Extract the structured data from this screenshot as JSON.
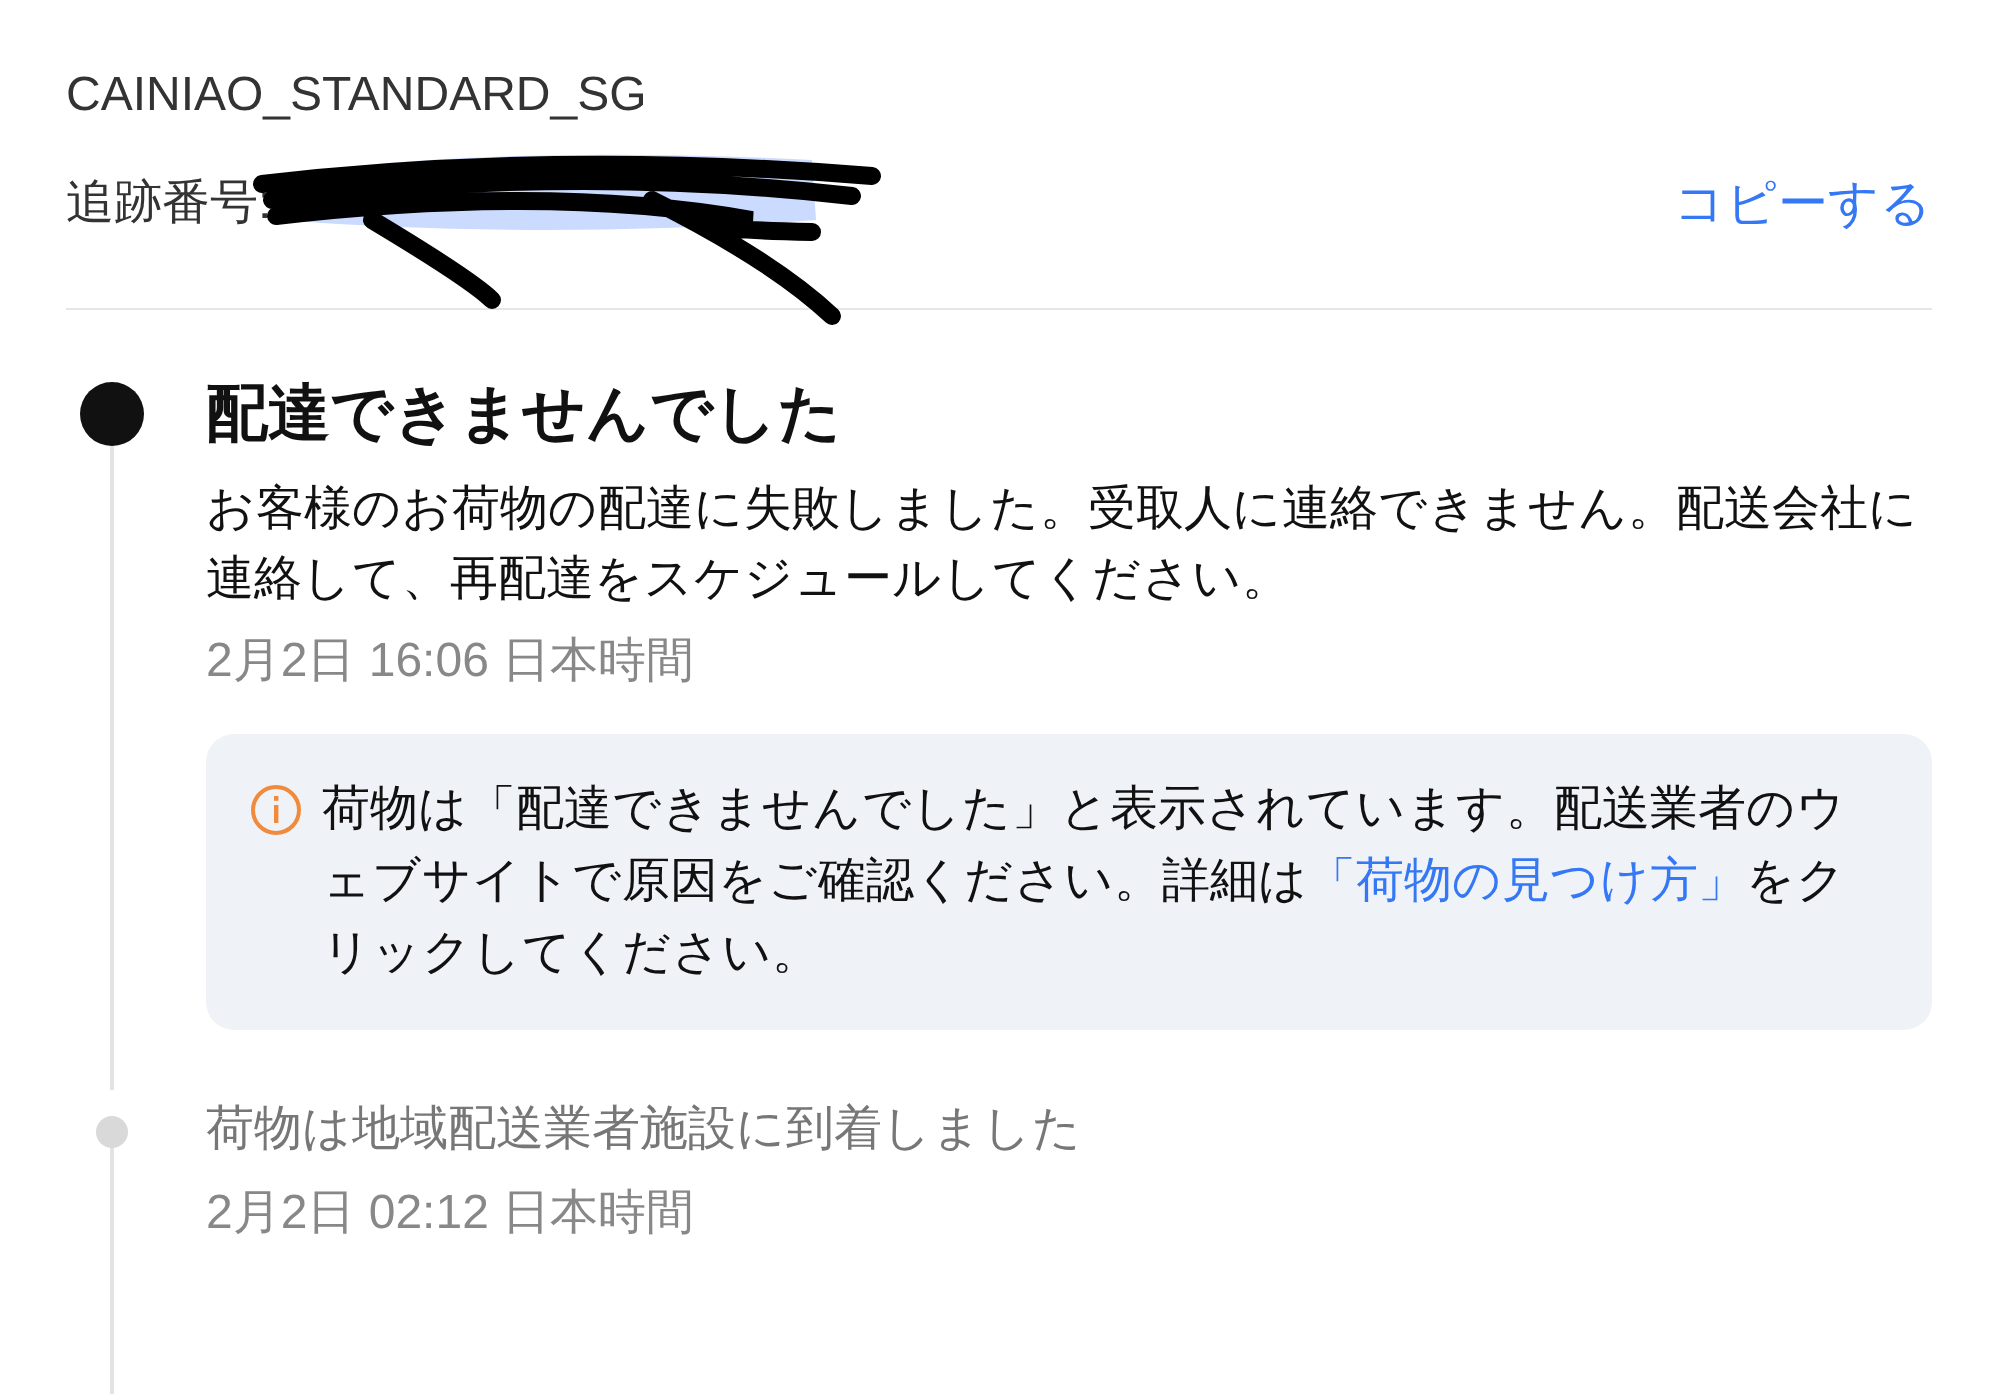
{
  "carrier": "CAINIAO_STANDARD_SG",
  "tracking": {
    "label": "追跡番号:",
    "copy_button": "コピーする"
  },
  "events": [
    {
      "kind": "current",
      "title": "配達できませんでした",
      "description": "お客様のお荷物の配達に失敗しました。受取人に連絡できません。配送会社に連絡して、再配達をスケジュールしてください。",
      "time": "2月2日 16:06 日本時間",
      "notice": {
        "text": "荷物は「配達できませんでした」と表示されています。配送業者のウェブサイトで原因をご確認ください。詳細は",
        "link": "「荷物の見つけ方」",
        "text_after": "をクリックしてください。"
      }
    },
    {
      "kind": "past",
      "title": "荷物は地域配送業者施設に到着しました",
      "time": "2月2日 02:12 日本時間"
    }
  ]
}
